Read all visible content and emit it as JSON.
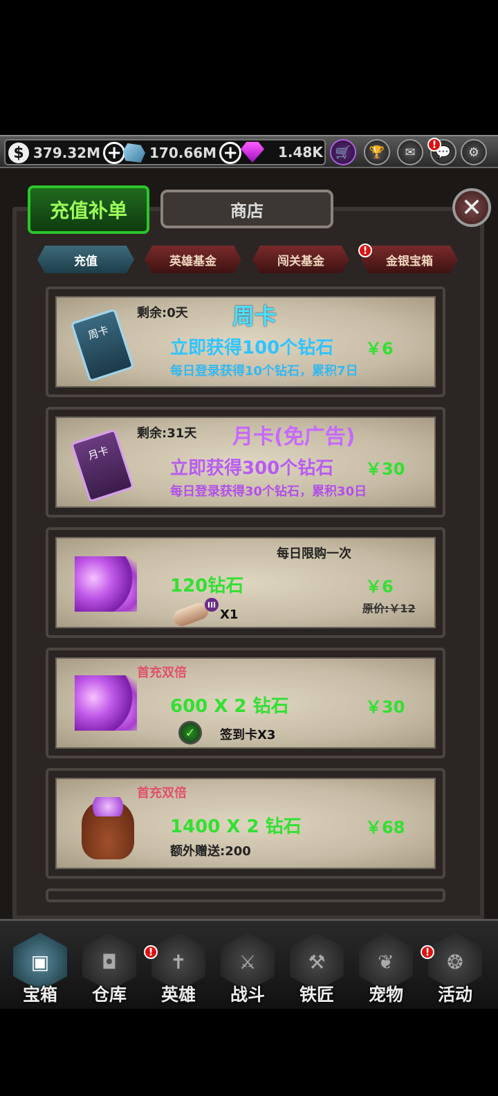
{
  "resources": {
    "gold": "379.32M",
    "crystal": "170.66M",
    "gem": "1.48K"
  },
  "header_icons": [
    "cart-icon",
    "trophy-icon",
    "mail-icon",
    "chat-icon",
    "gear-icon"
  ],
  "tabs": {
    "recharge_fix": "充值补单",
    "shop": "商店"
  },
  "subtabs": [
    {
      "label": "充值",
      "active": true,
      "alert": false
    },
    {
      "label": "英雄基金",
      "active": false,
      "alert": false
    },
    {
      "label": "闯关基金",
      "active": false,
      "alert": false
    },
    {
      "label": "金银宝箱",
      "active": false,
      "alert": true
    }
  ],
  "cards": [
    {
      "remaining": "剩余:0天",
      "title": "周卡",
      "title_color": "#4fdfff",
      "main": "立即获得100个钻石",
      "main_color": "#2ec4ff",
      "desc": "每日登录获得10个钻石，累积7日",
      "desc_color": "#34b8f0",
      "price": "￥6",
      "card_label": "周卡"
    },
    {
      "remaining": "剩余:31天",
      "title": "月卡(免广告)",
      "title_color": "#c768ff",
      "main": "立即获得300个钻石",
      "main_color": "#b75cf2",
      "desc": "每日登录获得30个钻石，累积30日",
      "desc_color": "#b250ea",
      "price": "￥30",
      "card_label": "月卡"
    },
    {
      "notice": "每日限购一次",
      "main": "120钻石",
      "price": "￥6",
      "original_price": "原价:￥12",
      "bonus_qty": "X1",
      "scroll_tier": "III"
    },
    {
      "tag": "首充双倍",
      "main": "600 X 2 钻石",
      "price": "￥30",
      "bonus": "签到卡X3"
    },
    {
      "tag": "首充双倍",
      "main": "1400 X 2 钻石",
      "price": "￥68",
      "extra": "额外赠送:200"
    }
  ],
  "price_color": "#32e032",
  "tag_color": "#e0506a",
  "nav": [
    {
      "label": "宝箱",
      "icon": "chest-icon",
      "active": true,
      "alert": false
    },
    {
      "label": "仓库",
      "icon": "backpack-icon",
      "active": false,
      "alert": false
    },
    {
      "label": "英雄",
      "icon": "sword-icon",
      "active": false,
      "alert": true
    },
    {
      "label": "战斗",
      "icon": "battle-icon",
      "active": false,
      "alert": false
    },
    {
      "label": "铁匠",
      "icon": "anvil-icon",
      "active": false,
      "alert": false
    },
    {
      "label": "宠物",
      "icon": "dragon-icon",
      "active": false,
      "alert": false
    },
    {
      "label": "活动",
      "icon": "swirl-icon",
      "active": false,
      "alert": true
    }
  ]
}
